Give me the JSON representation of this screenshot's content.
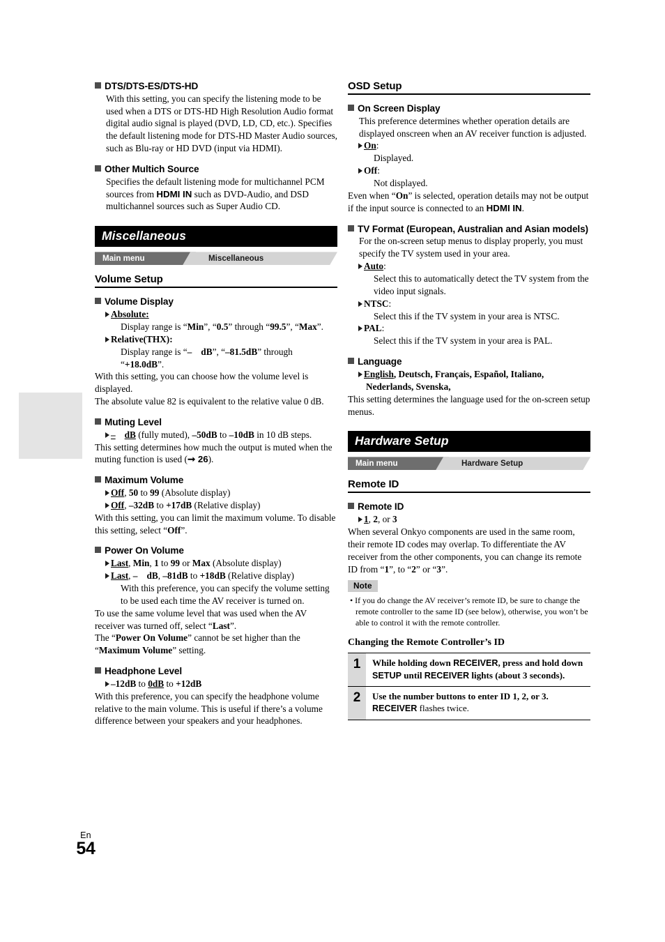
{
  "page": {
    "language_code": "En",
    "number": "54"
  },
  "left_column": {
    "dts": {
      "heading": "DTS/DTS-ES/DTS-HD",
      "body": "With this setting, you can specify the listening mode to be used when a DTS or DTS-HD High Resolution Audio format digital audio signal is played (DVD, LD, CD, etc.). Specifies the default listening mode for DTS-HD Master Audio sources, such as Blu-ray or HD DVD (input via HDMI)."
    },
    "other_multich": {
      "heading": "Other Multich Source",
      "body_part1": "Specifies the default listening mode for multichannel PCM sources from ",
      "body_bold": "HDMI IN",
      "body_part2": " such as DVD-Audio, and DSD multichannel sources such as Super Audio CD."
    },
    "banner": "Miscellaneous",
    "breadcrumb": {
      "main": "Main menu",
      "sub": "Miscellaneous"
    },
    "section_heading": "Volume Setup",
    "volume_display": {
      "heading": "Volume Display",
      "opt1_label": "Absolute:",
      "opt1_desc_a": "Display range is “",
      "opt1_desc_min": "Min",
      "opt1_desc_b": "”, “",
      "opt1_desc_val1": "0.5",
      "opt1_desc_c": "” through “",
      "opt1_desc_val2": "99.5",
      "opt1_desc_d": "”, “",
      "opt1_desc_max": "Max",
      "opt1_desc_e": "”.",
      "opt2_label": "Relative(THX):",
      "opt2_desc_a": "Display range is “",
      "opt2_desc_minus": "–",
      "opt2_desc_db": "dB",
      "opt2_desc_b": "”, “",
      "opt2_desc_val1": "–81.5dB",
      "opt2_desc_c": "” through “",
      "opt2_desc_val2": "+18.0dB",
      "opt2_desc_d": "”.",
      "note1": "With this setting, you can choose how the volume level is displayed.",
      "note2": "The absolute value 82 is equivalent to the relative value 0 dB."
    },
    "muting_level": {
      "heading": "Muting Level",
      "opt_minus": "–",
      "opt_db": "dB",
      "opt_a": " (fully muted), ",
      "opt_v1": "–50dB",
      "opt_b": " to ",
      "opt_v2": "–10dB",
      "opt_c": " in 10 dB steps.",
      "body_a": "This setting determines how much the output is muted when the muting function is used (",
      "body_ref": "26",
      "body_b": ")."
    },
    "maximum_volume": {
      "heading": "Maximum Volume",
      "opt1_off": "Off",
      "opt1_a": ", ",
      "opt1_v1": "50",
      "opt1_b": " to ",
      "opt1_v2": "99",
      "opt1_c": " (Absolute display)",
      "opt2_off": "Off",
      "opt2_a": ", ",
      "opt2_v1": "–32dB",
      "opt2_b": " to ",
      "opt2_v2": "+17dB",
      "opt2_c": " (Relative display)",
      "body_a": "With this setting, you can limit the maximum volume. To disable this setting, select “",
      "body_off": "Off",
      "body_b": "”."
    },
    "power_on_volume": {
      "heading": "Power On Volume",
      "opt1_last": "Last",
      "opt1_a": ", ",
      "opt1_min": "Min",
      "opt1_b": ", ",
      "opt1_v1": "1",
      "opt1_c": " to ",
      "opt1_v2": "99",
      "opt1_d": " or ",
      "opt1_max": "Max",
      "opt1_e": " (Absolute display)",
      "opt2_last": "Last",
      "opt2_a": ", ",
      "opt2_minus": "–",
      "opt2_db": "dB",
      "opt2_b": ", ",
      "opt2_v1": "–81dB",
      "opt2_c": " to ",
      "opt2_v2": "+18dB",
      "opt2_d": " (Relative display)",
      "opt2_desc": "With this preference, you can specify the volume setting to be used each time the AV receiver is turned on.",
      "body1_a": "To use the same volume level that was used when the AV receiver was turned off, select “",
      "body1_last": "Last",
      "body1_b": "”.",
      "body2_a": "The “",
      "body2_b1": "Power On Volume",
      "body2_b": "” cannot be set higher than the “",
      "body2_b2": "Maximum Volume",
      "body2_c": "” setting."
    },
    "headphone_level": {
      "heading": "Headphone Level",
      "opt_v1": "–12dB",
      "opt_a": " to ",
      "opt_v2": "0dB",
      "opt_b": " to ",
      "opt_v3": "+12dB",
      "body": "With this preference, you can specify the headphone volume relative to the main volume. This is useful if there’s a volume difference between your speakers and your headphones."
    }
  },
  "right_column": {
    "osd_section_heading": "OSD Setup",
    "on_screen_display": {
      "heading": "On Screen Display",
      "body": "This preference determines whether operation details are displayed onscreen when an AV receiver function is adjusted.",
      "opt1_label": "On",
      "opt1_colon": ":",
      "opt1_desc": "Displayed.",
      "opt2_label": "Off",
      "opt2_colon": ":",
      "opt2_desc": "Not displayed.",
      "note_a": "Even when “",
      "note_on": "On",
      "note_b": "” is selected, operation details may not be output if the input source is connected to an ",
      "note_hdmi": "HDMI IN",
      "note_c": "."
    },
    "tv_format": {
      "heading": "TV Format (European, Australian and Asian models)",
      "body": "For the on-screen setup menus to display properly, you must specify the TV system used in your area.",
      "opt1_label": "Auto",
      "opt1_colon": ":",
      "opt1_desc": "Select this to automatically detect the TV system from the video input signals.",
      "opt2_label": "NTSC",
      "opt2_colon": ":",
      "opt2_desc": "Select this if the TV system in your area is NTSC.",
      "opt3_label": "PAL",
      "opt3_colon": ":",
      "opt3_desc": "Select this if the TV system in your area is PAL."
    },
    "language": {
      "heading": "Language",
      "opt_first": "English",
      "opt_rest": ", Deutsch, Français, Español, Italiano, Nederlands, Svenska,",
      "body": "This setting determines the language used for the on-screen setup menus."
    },
    "banner": "Hardware Setup",
    "breadcrumb": {
      "main": "Main menu",
      "sub": "Hardware Setup"
    },
    "remote_section_heading": "Remote ID",
    "remote_id": {
      "heading": "Remote ID",
      "opt_v1": "1",
      "opt_a": ", ",
      "opt_v2": "2",
      "opt_b": ", or ",
      "opt_v3": "3",
      "body_a": "When several Onkyo components are used in the same room, their remote ID codes may overlap. To differentiate the AV receiver from the other components, you can change its remote ID from “",
      "body_v1": "1",
      "body_b": "”, to “",
      "body_v2": "2",
      "body_c": "” or “",
      "body_v3": "3",
      "body_d": "”."
    },
    "note": {
      "tag": "Note",
      "text": "• If you do change the AV receiver’s remote ID, be sure to change the remote controller to the same ID (see below), otherwise, you won’t be able to control it with the remote controller."
    },
    "changing_title": "Changing the Remote Controller’s ID",
    "steps": [
      {
        "num": "1",
        "a": "While holding down ",
        "k1": "RECEIVER",
        "b": ", press and hold down ",
        "k2": "SETUP",
        "c": " until ",
        "k3": "RECEIVER",
        "d": " lights (about 3 seconds)."
      },
      {
        "num": "2",
        "a": "Use the number buttons to enter ID 1, 2, or 3. ",
        "k1": "RECEIVER",
        "b": "",
        "k2": "",
        "c": "",
        "k3": "",
        "d": " flashes twice."
      }
    ]
  }
}
